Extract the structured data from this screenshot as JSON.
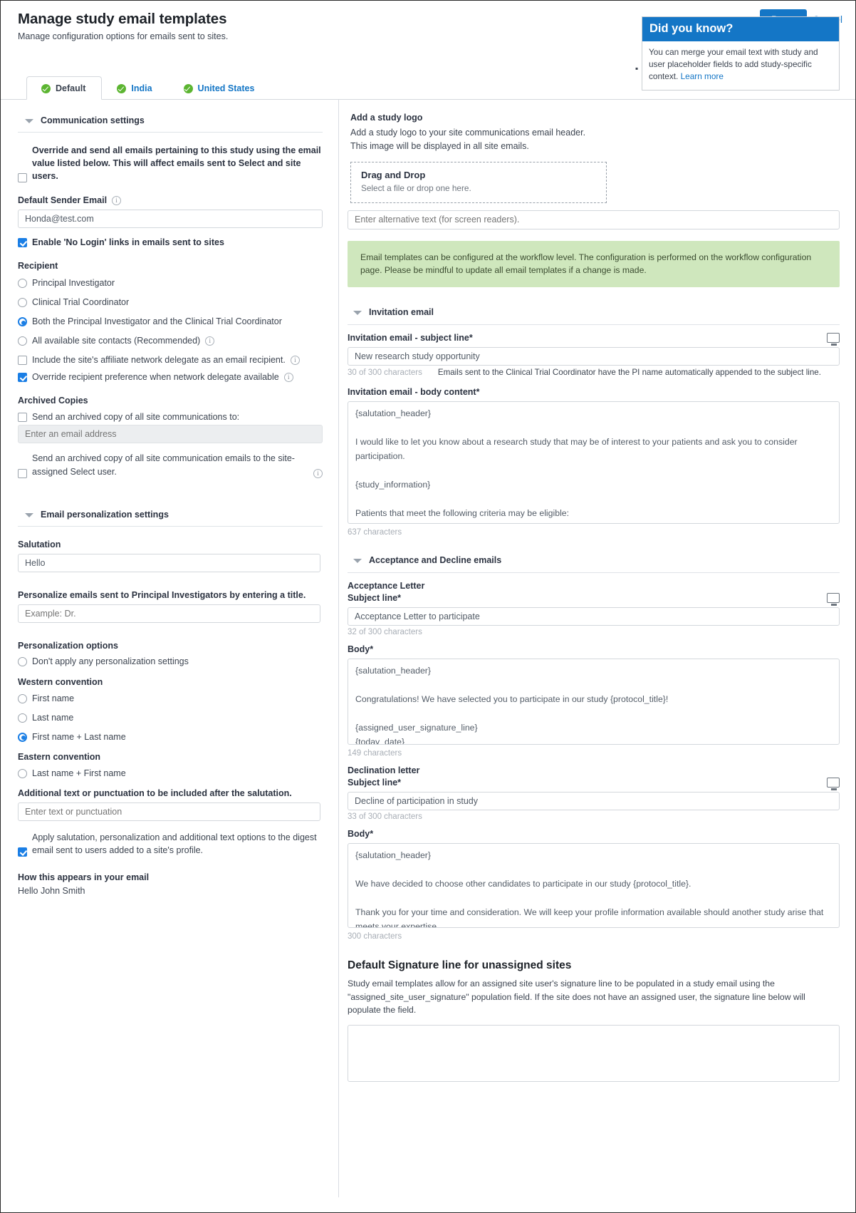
{
  "header": {
    "title": "Manage study email templates",
    "subtitle": "Manage configuration options for emails sent to sites.",
    "done_label": "Done",
    "cancel_label": "Cancel"
  },
  "tabs": [
    {
      "label": "Default",
      "active": true
    },
    {
      "label": "India",
      "active": false
    },
    {
      "label": "United States",
      "active": false
    }
  ],
  "left": {
    "communication_settings": {
      "section_title": "Communication settings",
      "override_checkbox": "Override and send all emails pertaining to this study using the email value listed below. This will affect emails sent to Select and site users.",
      "sender_label": "Default Sender Email",
      "sender_value": "Honda@test.com",
      "nologin_checkbox": "Enable 'No Login' links in emails sent to sites",
      "recipient_title": "Recipient",
      "recipient_options": [
        "Principal Investigator",
        "Clinical Trial Coordinator",
        "Both the Principal Investigator and the Clinical Trial Coordinator",
        "All available site contacts (Recommended)"
      ],
      "affiliate_checkbox": "Include the site's affiliate network delegate as an email recipient.",
      "override_pref_checkbox": "Override recipient preference when network delegate available",
      "archived_title": "Archived Copies",
      "archived_copy_checkbox": "Send an archived copy of all site communications to:",
      "archived_email_placeholder": "Enter an email address",
      "archived_select_checkbox": "Send an archived copy of all site communication emails to the site-assigned Select user."
    },
    "personalization": {
      "section_title": "Email personalization settings",
      "salutation_label": "Salutation",
      "salutation_value": "Hello",
      "title_label": "Personalize emails sent to Principal Investigators by entering a title.",
      "title_placeholder": "Example: Dr.",
      "options_title": "Personalization options",
      "no_personalization": "Don't apply any personalization settings",
      "western_title": "Western convention",
      "western_options": [
        "First name",
        "Last name",
        "First name + Last name"
      ],
      "eastern_title": "Eastern convention",
      "eastern_options": [
        "Last name + First name"
      ],
      "additional_label": "Additional text or punctuation to be included after the salutation.",
      "additional_placeholder": "Enter text or punctuation",
      "digest_checkbox": "Apply salutation, personalization and additional text options to the digest email sent to users added to a site's profile.",
      "preview_title": "How this appears in your email",
      "preview_value": "Hello John Smith"
    }
  },
  "right": {
    "logo": {
      "title": "Add a study logo",
      "desc": "Add a study logo to your site communications email header. This image will be displayed in all site emails.",
      "drop_title": "Drag and Drop",
      "drop_sub": "Select a file or drop one here.",
      "alt_placeholder": "Enter alternative text (for screen readers)."
    },
    "did_you_know": {
      "title": "Did you know?",
      "body": "You can merge your email text with study and user placeholder fields to add study-specific context. ",
      "link": "Learn more"
    },
    "green_notice": "Email templates can be configured at the workflow level. The configuration is performed on the workflow configuration page. Please be mindful to update all email templates if a change is made.",
    "invitation": {
      "section_title": "Invitation email",
      "subject_label": "Invitation email - subject line*",
      "subject_value": "New research study opportunity",
      "subject_counter": "30 of 300 characters",
      "subject_note": "Emails sent to the Clinical Trial Coordinator have the PI name automatically appended to the subject line.",
      "body_label": "Invitation email - body content*",
      "body_value": "{salutation_header}\n\nI would like to let you know about a research study that may be of interest to your patients and ask you to consider participation.\n\n{study_information}\n\nPatients that meet the following criteria may be eligible:\n[DETAIL MAIN INCLUSION/ MAIN EXCLUSION CRITERIA – IT IS HELPFUL TO LIST ~3 MAIN CRITERIA IN SIMPLE LANGUAGE]",
      "body_counter": "637 characters"
    },
    "acceptance_decline": {
      "section_title": "Acceptance and Decline emails",
      "acceptance_title": "Acceptance Letter",
      "acceptance_subject_label": "Subject line*",
      "acceptance_subject_value": "Acceptance Letter to participate",
      "acceptance_subject_counter": "32 of 300 characters",
      "acceptance_body_label": "Body*",
      "acceptance_body_value": "{salutation_header}\n\nCongratulations! We have selected you to participate in our study {protocol_title}!\n\n{assigned_user_signature_line}\n{today_date}",
      "acceptance_body_counter": "149 characters",
      "declination_title": "Declination letter",
      "declination_subject_label": "Subject line*",
      "declination_subject_value": "Decline of participation in study",
      "declination_subject_counter": "33 of 300 characters",
      "declination_body_label": "Body*",
      "declination_body_value": "{salutation_header}\n\nWe have decided to choose other candidates to participate in our study {protocol_title}.\n\nThank you for your time and consideration. We will keep your profile information available should another study arise that meets your expertise.\n\n{assigned_user_signature_line}",
      "declination_body_counter": "300 characters"
    },
    "signature": {
      "title": "Default Signature line for unassigned sites",
      "desc": "Study email templates allow for an assigned site user's signature line to be populated in a study email using the \"assigned_site_user_signature\" population field. If the site does not have an assigned user, the signature line below will populate the field.",
      "value": ""
    }
  }
}
